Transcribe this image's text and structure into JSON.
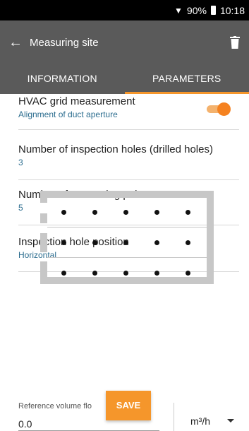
{
  "status": {
    "battery": "90%",
    "time": "10:18"
  },
  "appbar": {
    "title": "Measuring site"
  },
  "tabs": [
    {
      "label": "INFORMATION",
      "active": false
    },
    {
      "label": "PARAMETERS",
      "active": true
    }
  ],
  "params": {
    "hvac": {
      "label": "HVAC grid measurement",
      "value": "Alignment of duct aperture",
      "toggle_on": true
    },
    "holes": {
      "label": "Number of inspection holes (drilled holes)",
      "value": "3"
    },
    "points": {
      "label": "Number of measuring points",
      "value": "5"
    },
    "position": {
      "label": "Inspection hole position",
      "value": "Horizontal"
    }
  },
  "grid": {
    "rows": 3,
    "cols": 5
  },
  "footer": {
    "ref_label": "Reference volume flo",
    "ref_value": "0.0",
    "save_label": "SAVE",
    "unit": "m³/h"
  },
  "colors": {
    "accent": "#f5962b",
    "appbar": "#5a5a5a",
    "value_text": "#2c6d8f"
  }
}
